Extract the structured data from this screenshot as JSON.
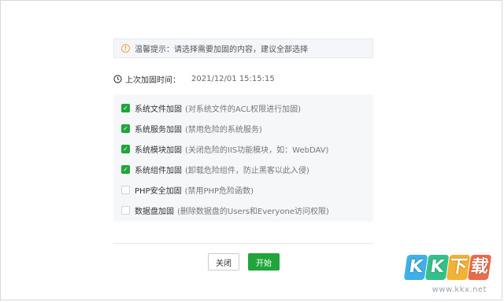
{
  "tip": {
    "text": "温馨提示：请选择需要加固的内容，建议全部选择"
  },
  "last_time": {
    "label": "上次加固时间：",
    "value": "2021/12/01 15:15:15"
  },
  "options": [
    {
      "name": "系统文件加固",
      "desc": "(对系统文件的ACL权限进行加固)",
      "checked": true
    },
    {
      "name": "系统服务加固",
      "desc": "(禁用危险的系统服务)",
      "checked": true
    },
    {
      "name": "系统模块加固",
      "desc": "(关闭危险的IIS功能模块，如：WebDAV)",
      "checked": true
    },
    {
      "name": "系统组件加固",
      "desc": "(卸载危险组件，防止黑客以此入侵)",
      "checked": true
    },
    {
      "name": "PHP安全加固",
      "desc": "(禁用PHP危险函数)",
      "checked": false
    },
    {
      "name": "数据盘加固",
      "desc": "(删除数据盘的Users和Everyone访问权限)",
      "checked": false
    }
  ],
  "buttons": {
    "close": "关闭",
    "start": "开始"
  },
  "watermark": {
    "logo": [
      "K",
      "K",
      "下",
      "载"
    ],
    "url": "www.kkx.net"
  },
  "colors": {
    "accent": "#20a53a",
    "warning": "#f0a14a"
  }
}
